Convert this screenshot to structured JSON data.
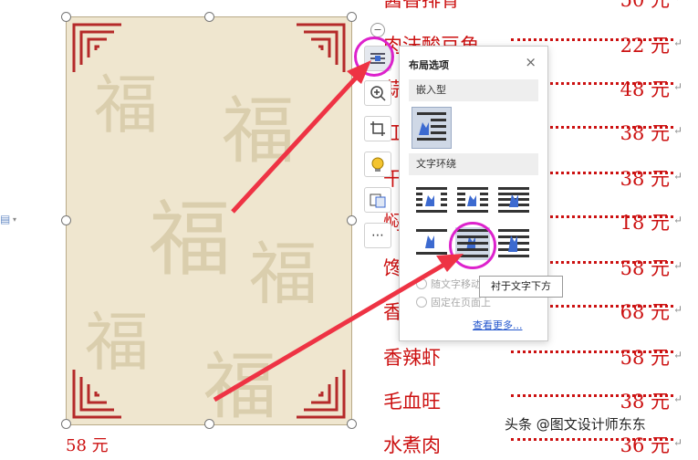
{
  "menu": [
    {
      "dish": "酱香排骨",
      "price": "50 元"
    },
    {
      "dish": "肉沫酸豆角",
      "price": "22 元"
    },
    {
      "dish": "蒜蓉蛏子",
      "price": "48 元"
    },
    {
      "dish": "红烧肉",
      "price": "38 元"
    },
    {
      "dish": "干煸豆角",
      "price": "38 元"
    },
    {
      "dish": "焖茄子",
      "price": "18 元"
    },
    {
      "dish": "馋嘴蛙",
      "price": "58 元"
    },
    {
      "dish": "香辣蟹",
      "price": "68 元"
    },
    {
      "dish": "香辣虾",
      "price": "58 元"
    },
    {
      "dish": "毛血旺",
      "price": "38 元"
    },
    {
      "dish": "水煮肉",
      "price": "36 元"
    }
  ],
  "bottom_left_text": "58 元",
  "layout_panel": {
    "title": "布局选项",
    "inline_section": "嵌入型",
    "wrap_section": "文字环绕",
    "option_move": "随文字移动",
    "option_fixed": "固定在页面上",
    "see_more": "查看更多..."
  },
  "tooltip": "衬于文字下方",
  "watermark": "头条 @图文设计师东东",
  "colors": {
    "text_red": "#cc1111",
    "highlight": "#dd22cc",
    "arrow": "#ee3344",
    "icon_blue": "#3c6ad0"
  }
}
